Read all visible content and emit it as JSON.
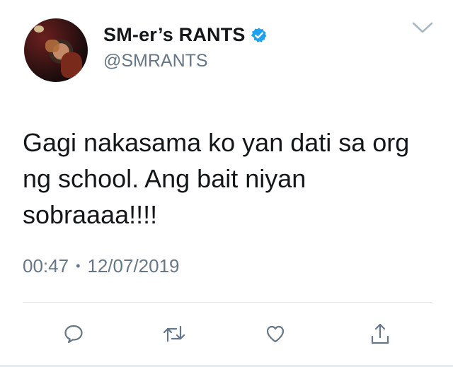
{
  "tweet": {
    "display_name": "SM-er’s RANTS",
    "handle": "@SMRANTS",
    "text": "Gagi nakasama ko yan dati sa org ng school. Ang bait niyan sobraaaa!!!!",
    "time": "00:47",
    "separator": "•",
    "date": "12/07/2019",
    "verified": true
  },
  "icons": {
    "menu": "chevron-down-icon",
    "reply": "speech-bubble-icon",
    "retweet": "retweet-icon",
    "like": "heart-icon",
    "share": "share-icon",
    "verified": "verified-badge-icon"
  },
  "colors": {
    "text_primary": "#14171a",
    "text_secondary": "#657786",
    "verified_blue": "#1da1f2",
    "divider": "#e1e8ed"
  }
}
